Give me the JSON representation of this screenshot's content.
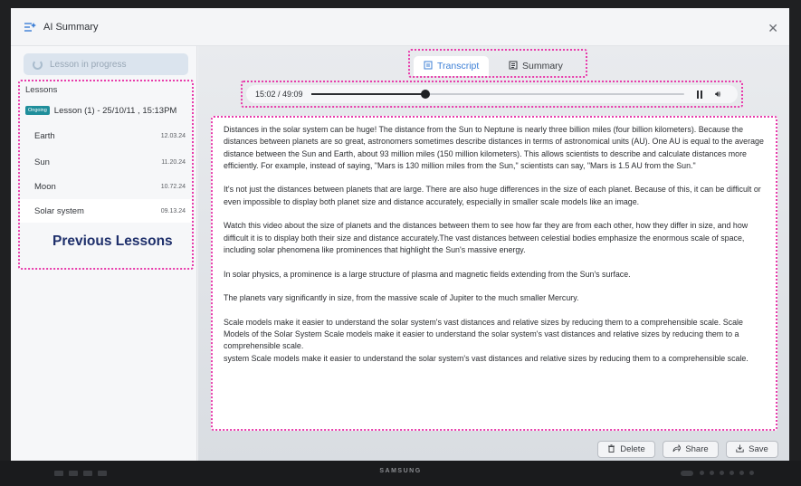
{
  "window": {
    "title": "AI Summary"
  },
  "sidebar": {
    "progress_label": "Lesson in progress",
    "lessons_header": "Lessons",
    "current": {
      "badge": "Ongoing",
      "label": "Lesson (1) - 25/10/11 , 15:13PM"
    },
    "items": [
      {
        "name": "Earth",
        "date": "12.03.24"
      },
      {
        "name": "Sun",
        "date": "11.20.24"
      },
      {
        "name": "Moon",
        "date": "10.72.24"
      },
      {
        "name": "Solar system",
        "date": "09.13.24"
      }
    ],
    "annotation": "Previous Lessons"
  },
  "tabs": [
    {
      "label": "Transcript",
      "active": true
    },
    {
      "label": "Summary",
      "active": false
    }
  ],
  "player": {
    "time": "15:02 / 49:09",
    "progress": 0.306
  },
  "transcript": [
    "Distances in the solar system can be huge! The distance from the Sun to Neptune is nearly three billion miles (four billion kilometers). Because the distances between planets are so great, astronomers sometimes describe distances in terms of astronomical units (AU). One AU is equal to the average distance between the Sun and Earth, about 93 million miles (150 million kilometers). This allows scientists to describe and calculate distances more efficiently. For example, instead of saying, \"Mars is 130 million miles from the Sun,\" scientists can say, \"Mars is 1.5 AU from the Sun.\"",
    "It's not just the distances between planets that are large. There are also huge differences in the size of each planet. Because of this, it can be difficult or even impossible to display both planet size and distance accurately, especially in smaller scale models like an image.",
    "Watch this video about the size of planets and the distances between them to see how far they are from each other, how they differ in size, and how difficult it is to display both their size and distance accurately.The vast distances between celestial bodies emphasize the enormous scale of space, including solar phenomena like prominences that highlight the Sun's massive energy.",
    "In solar physics, a prominence is a large structure of plasma and magnetic fields extending from the Sun's surface.",
    "The planets vary significantly in size, from the massive scale of Jupiter to the much smaller Mercury.",
    "Scale models make it easier to understand the solar system's vast distances and relative sizes by reducing them to a comprehensible scale. Scale Models of the Solar System Scale models make it easier to understand the solar system's vast distances and relative sizes by reducing them to a comprehensible scale.",
    "system Scale models make it easier to understand the solar system's vast distances and relative sizes by reducing them to a comprehensible scale."
  ],
  "actions": {
    "delete": "Delete",
    "share": "Share",
    "save": "Save"
  },
  "device": {
    "brand": "SAMSUNG"
  },
  "colors": {
    "accent": "#3c7fd6",
    "annotation": "#e83cab",
    "badge": "#1f8e9b",
    "heading": "#1e2f6b"
  }
}
